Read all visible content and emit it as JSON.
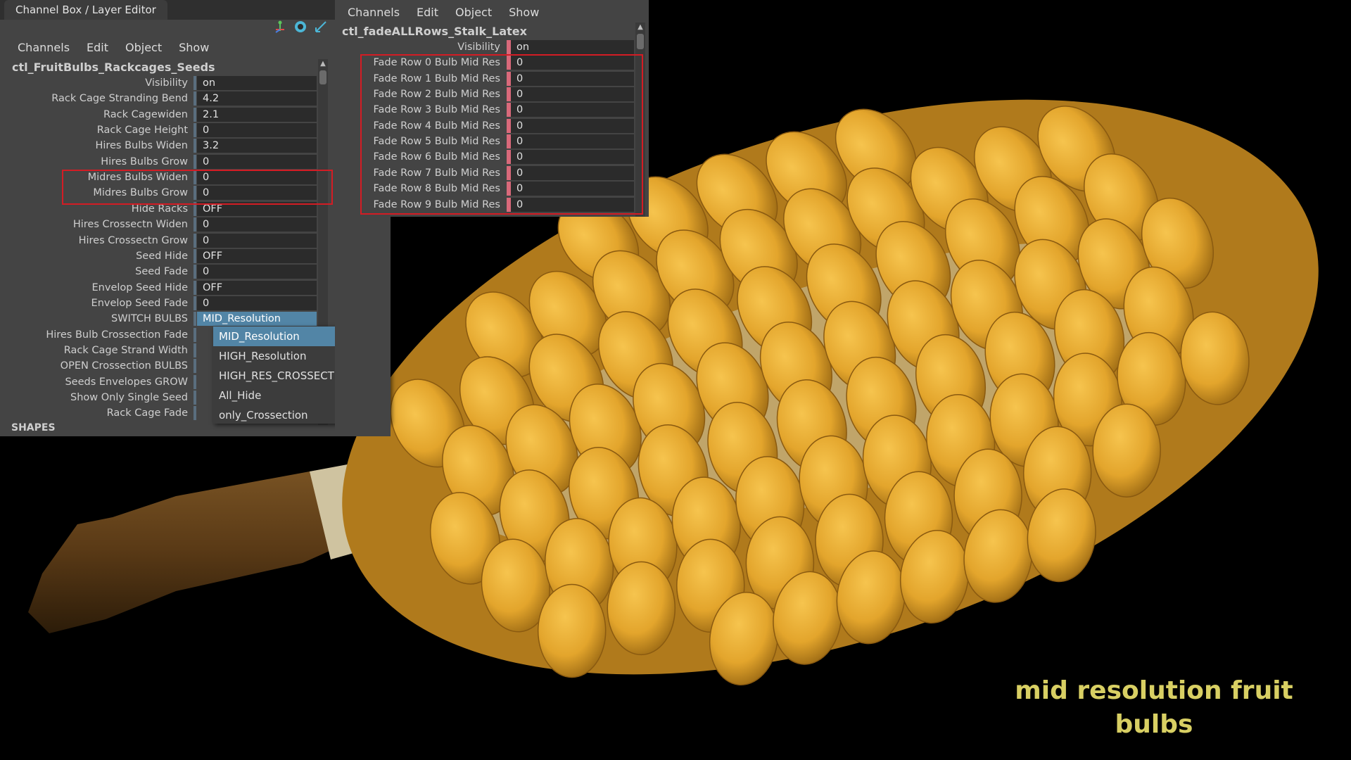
{
  "left_panel": {
    "title": "Channel Box / Layer Editor",
    "menu": [
      "Channels",
      "Edit",
      "Object",
      "Show"
    ],
    "object_name": "ctl_FruitBulbs_Rackcages_Seeds",
    "attributes": [
      {
        "label": "Visibility",
        "value": "on"
      },
      {
        "label": "Rack Cage Stranding Bend",
        "value": "4.2"
      },
      {
        "label": "Rack Cagewiden",
        "value": "2.1"
      },
      {
        "label": "Rack Cage Height",
        "value": "0"
      },
      {
        "label": "Hires Bulbs Widen",
        "value": "3.2"
      },
      {
        "label": "Hires Bulbs Grow",
        "value": "0"
      },
      {
        "label": "Midres Bulbs Widen",
        "value": "0"
      },
      {
        "label": "Midres Bulbs Grow",
        "value": "0"
      },
      {
        "label": "Hide Racks",
        "value": "OFF"
      },
      {
        "label": "Hires Crossectn Widen",
        "value": "0"
      },
      {
        "label": "Hires Crossectn Grow",
        "value": "0"
      },
      {
        "label": "Seed Hide",
        "value": "OFF"
      },
      {
        "label": "Seed Fade",
        "value": "0"
      },
      {
        "label": "Envelop Seed Hide",
        "value": "OFF"
      },
      {
        "label": "Envelop Seed Fade",
        "value": "0"
      },
      {
        "label": "SWITCH BULBS",
        "value": "MID_Resolution"
      },
      {
        "label": "Hires Bulb Crossection Fade",
        "value": ""
      },
      {
        "label": "Rack Cage Strand Width",
        "value": ""
      },
      {
        "label": "OPEN Crossection BULBS",
        "value": ""
      },
      {
        "label": "Seeds Envelopes GROW",
        "value": ""
      },
      {
        "label": "Show Only Single Seed",
        "value": ""
      },
      {
        "label": "Rack Cage Fade",
        "value": ""
      }
    ],
    "shapes_header": "SHAPES",
    "dropdown_options": [
      "MID_Resolution",
      "HIGH_Resolution",
      "HIGH_RES_CROSSECTION",
      "All_Hide",
      "only_Crossection"
    ],
    "dropdown_selected": "MID_Resolution"
  },
  "right_panel": {
    "menu": [
      "Channels",
      "Edit",
      "Object",
      "Show"
    ],
    "object_name": "ctl_fadeALLRows_Stalk_Latex",
    "attributes": [
      {
        "label": "Visibility",
        "value": "on"
      },
      {
        "label": "Fade Row 0 Bulb Mid Res",
        "value": "0"
      },
      {
        "label": "Fade Row 1 Bulb Mid Res",
        "value": "0"
      },
      {
        "label": "Fade Row 2 Bulb Mid Res",
        "value": "0"
      },
      {
        "label": "Fade Row 3 Bulb Mid Res",
        "value": "0"
      },
      {
        "label": "Fade Row 4 Bulb Mid Res",
        "value": "0"
      },
      {
        "label": "Fade Row 5 Bulb Mid Res",
        "value": "0"
      },
      {
        "label": "Fade Row 6 Bulb Mid Res",
        "value": "0"
      },
      {
        "label": "Fade Row 7 Bulb Mid Res",
        "value": "0"
      },
      {
        "label": "Fade Row 8 Bulb Mid Res",
        "value": "0"
      },
      {
        "label": "Fade Row 9 Bulb Mid Res",
        "value": "0"
      }
    ]
  },
  "caption": {
    "line1": "mid resolution fruit",
    "line2": "bulbs"
  },
  "colors": {
    "highlight_box": "#d41c24",
    "caption": "#d8cf63",
    "fruit": "#e3a52c",
    "selection": "#5285a6"
  },
  "icons": [
    "move-tool-icon",
    "orbit-icon",
    "select-icon",
    "fruit-render-image"
  ]
}
